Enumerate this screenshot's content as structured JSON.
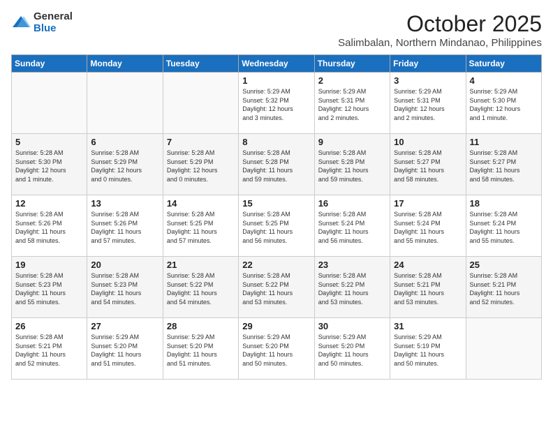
{
  "logo": {
    "general": "General",
    "blue": "Blue"
  },
  "title": "October 2025",
  "location": "Salimbalan, Northern Mindanao, Philippines",
  "headers": [
    "Sunday",
    "Monday",
    "Tuesday",
    "Wednesday",
    "Thursday",
    "Friday",
    "Saturday"
  ],
  "weeks": [
    [
      {
        "day": "",
        "info": ""
      },
      {
        "day": "",
        "info": ""
      },
      {
        "day": "",
        "info": ""
      },
      {
        "day": "1",
        "info": "Sunrise: 5:29 AM\nSunset: 5:32 PM\nDaylight: 12 hours\nand 3 minutes."
      },
      {
        "day": "2",
        "info": "Sunrise: 5:29 AM\nSunset: 5:31 PM\nDaylight: 12 hours\nand 2 minutes."
      },
      {
        "day": "3",
        "info": "Sunrise: 5:29 AM\nSunset: 5:31 PM\nDaylight: 12 hours\nand 2 minutes."
      },
      {
        "day": "4",
        "info": "Sunrise: 5:29 AM\nSunset: 5:30 PM\nDaylight: 12 hours\nand 1 minute."
      }
    ],
    [
      {
        "day": "5",
        "info": "Sunrise: 5:28 AM\nSunset: 5:30 PM\nDaylight: 12 hours\nand 1 minute."
      },
      {
        "day": "6",
        "info": "Sunrise: 5:28 AM\nSunset: 5:29 PM\nDaylight: 12 hours\nand 0 minutes."
      },
      {
        "day": "7",
        "info": "Sunrise: 5:28 AM\nSunset: 5:29 PM\nDaylight: 12 hours\nand 0 minutes."
      },
      {
        "day": "8",
        "info": "Sunrise: 5:28 AM\nSunset: 5:28 PM\nDaylight: 11 hours\nand 59 minutes."
      },
      {
        "day": "9",
        "info": "Sunrise: 5:28 AM\nSunset: 5:28 PM\nDaylight: 11 hours\nand 59 minutes."
      },
      {
        "day": "10",
        "info": "Sunrise: 5:28 AM\nSunset: 5:27 PM\nDaylight: 11 hours\nand 58 minutes."
      },
      {
        "day": "11",
        "info": "Sunrise: 5:28 AM\nSunset: 5:27 PM\nDaylight: 11 hours\nand 58 minutes."
      }
    ],
    [
      {
        "day": "12",
        "info": "Sunrise: 5:28 AM\nSunset: 5:26 PM\nDaylight: 11 hours\nand 58 minutes."
      },
      {
        "day": "13",
        "info": "Sunrise: 5:28 AM\nSunset: 5:26 PM\nDaylight: 11 hours\nand 57 minutes."
      },
      {
        "day": "14",
        "info": "Sunrise: 5:28 AM\nSunset: 5:25 PM\nDaylight: 11 hours\nand 57 minutes."
      },
      {
        "day": "15",
        "info": "Sunrise: 5:28 AM\nSunset: 5:25 PM\nDaylight: 11 hours\nand 56 minutes."
      },
      {
        "day": "16",
        "info": "Sunrise: 5:28 AM\nSunset: 5:24 PM\nDaylight: 11 hours\nand 56 minutes."
      },
      {
        "day": "17",
        "info": "Sunrise: 5:28 AM\nSunset: 5:24 PM\nDaylight: 11 hours\nand 55 minutes."
      },
      {
        "day": "18",
        "info": "Sunrise: 5:28 AM\nSunset: 5:24 PM\nDaylight: 11 hours\nand 55 minutes."
      }
    ],
    [
      {
        "day": "19",
        "info": "Sunrise: 5:28 AM\nSunset: 5:23 PM\nDaylight: 11 hours\nand 55 minutes."
      },
      {
        "day": "20",
        "info": "Sunrise: 5:28 AM\nSunset: 5:23 PM\nDaylight: 11 hours\nand 54 minutes."
      },
      {
        "day": "21",
        "info": "Sunrise: 5:28 AM\nSunset: 5:22 PM\nDaylight: 11 hours\nand 54 minutes."
      },
      {
        "day": "22",
        "info": "Sunrise: 5:28 AM\nSunset: 5:22 PM\nDaylight: 11 hours\nand 53 minutes."
      },
      {
        "day": "23",
        "info": "Sunrise: 5:28 AM\nSunset: 5:22 PM\nDaylight: 11 hours\nand 53 minutes."
      },
      {
        "day": "24",
        "info": "Sunrise: 5:28 AM\nSunset: 5:21 PM\nDaylight: 11 hours\nand 53 minutes."
      },
      {
        "day": "25",
        "info": "Sunrise: 5:28 AM\nSunset: 5:21 PM\nDaylight: 11 hours\nand 52 minutes."
      }
    ],
    [
      {
        "day": "26",
        "info": "Sunrise: 5:28 AM\nSunset: 5:21 PM\nDaylight: 11 hours\nand 52 minutes."
      },
      {
        "day": "27",
        "info": "Sunrise: 5:29 AM\nSunset: 5:20 PM\nDaylight: 11 hours\nand 51 minutes."
      },
      {
        "day": "28",
        "info": "Sunrise: 5:29 AM\nSunset: 5:20 PM\nDaylight: 11 hours\nand 51 minutes."
      },
      {
        "day": "29",
        "info": "Sunrise: 5:29 AM\nSunset: 5:20 PM\nDaylight: 11 hours\nand 50 minutes."
      },
      {
        "day": "30",
        "info": "Sunrise: 5:29 AM\nSunset: 5:20 PM\nDaylight: 11 hours\nand 50 minutes."
      },
      {
        "day": "31",
        "info": "Sunrise: 5:29 AM\nSunset: 5:19 PM\nDaylight: 11 hours\nand 50 minutes."
      },
      {
        "day": "",
        "info": ""
      }
    ]
  ]
}
